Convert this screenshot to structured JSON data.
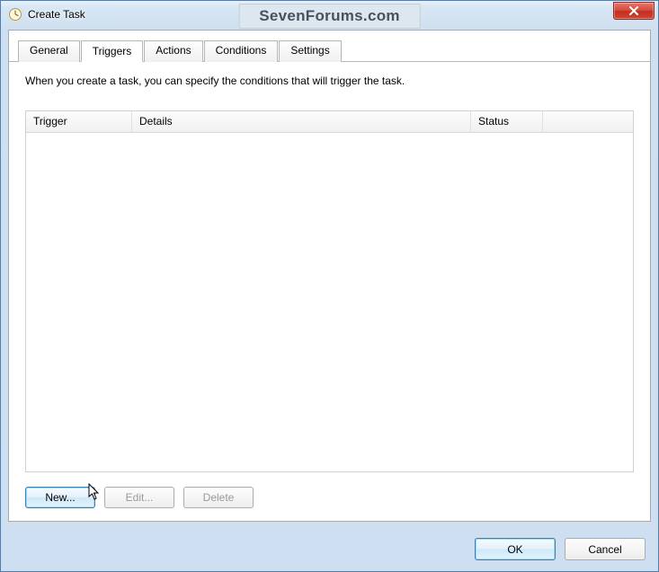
{
  "window": {
    "title": "Create Task",
    "watermark": "SevenForums.com"
  },
  "tabs": {
    "items": [
      {
        "label": "General"
      },
      {
        "label": "Triggers"
      },
      {
        "label": "Actions"
      },
      {
        "label": "Conditions"
      },
      {
        "label": "Settings"
      }
    ],
    "active_index": 1
  },
  "triggers_panel": {
    "description": "When you create a task, you can specify the conditions that will trigger the task.",
    "columns": {
      "trigger": "Trigger",
      "details": "Details",
      "status": "Status"
    },
    "rows": [],
    "buttons": {
      "new": "New...",
      "edit": "Edit...",
      "delete": "Delete"
    }
  },
  "footer": {
    "ok": "OK",
    "cancel": "Cancel"
  }
}
